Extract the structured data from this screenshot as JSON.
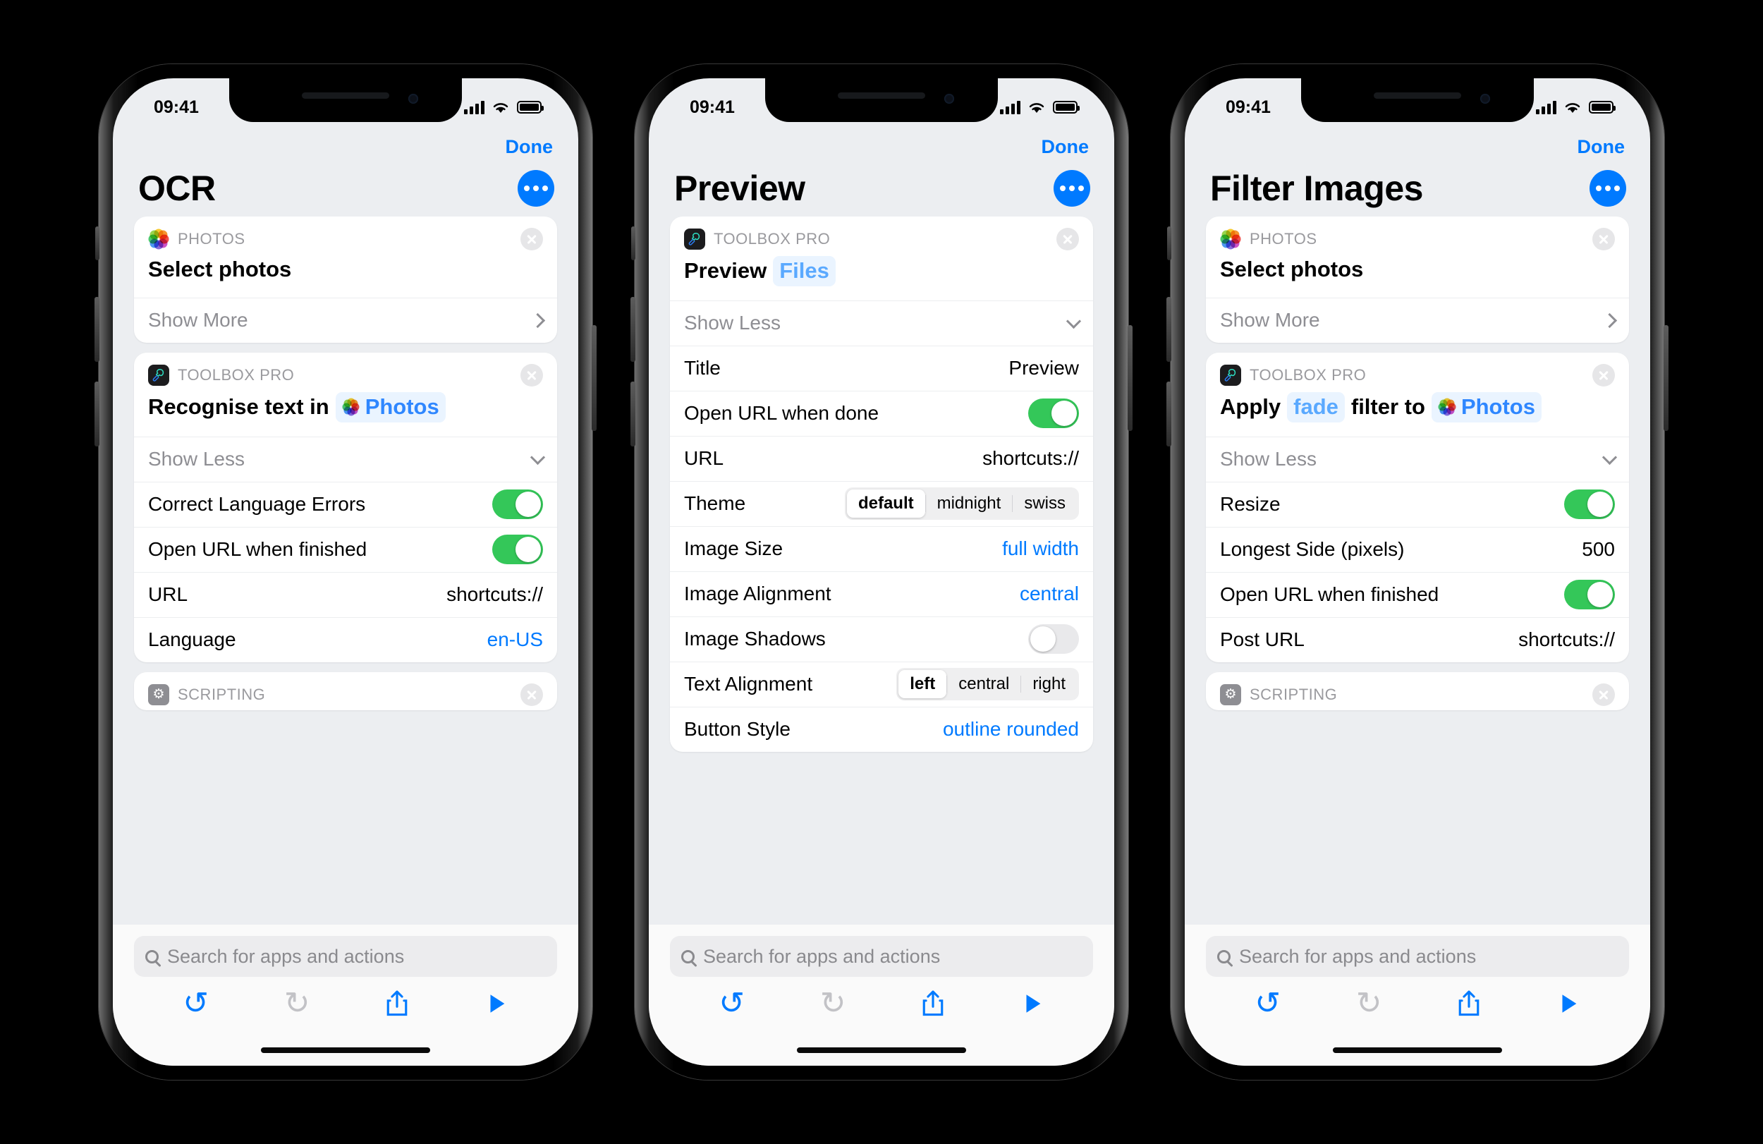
{
  "colors": {
    "accent": "#007aff",
    "toggle_on": "#34c759",
    "token_bg": "#eaf4ff",
    "token_text": "#2f87ff"
  },
  "status": {
    "time": "09:41",
    "signal_icon": "cellular-bars-icon",
    "wifi_icon": "wifi-icon",
    "battery_icon": "battery-full-icon"
  },
  "search": {
    "placeholder": "Search for apps and actions",
    "icon": "search-icon"
  },
  "toolbar": {
    "undo": "undo-icon",
    "redo": "redo-icon",
    "share": "share-icon",
    "run": "play-icon"
  },
  "phones": [
    {
      "nav": {
        "done": "Done",
        "title": "OCR",
        "more": "more-options-button"
      },
      "cards": [
        {
          "app": "PHOTOS",
          "app_icon": "photos-icon",
          "title_parts": [
            {
              "type": "text",
              "text": "Select photos"
            }
          ],
          "rows": [
            {
              "label": "Show More",
              "kind": "disclosure",
              "dim": true,
              "chevron": "chevron-right-icon"
            }
          ]
        },
        {
          "app": "TOOLBOX PRO",
          "app_icon": "toolbox-pro-icon",
          "title_parts": [
            {
              "type": "text",
              "text": "Recognise text in"
            },
            {
              "type": "token",
              "text": "Photos",
              "icon": "photos-icon"
            }
          ],
          "rows": [
            {
              "label": "Show Less",
              "kind": "disclosure",
              "dim": true,
              "chevron": "chevron-down-icon"
            },
            {
              "label": "Correct Language Errors",
              "kind": "toggle",
              "value": true
            },
            {
              "label": "Open URL when finished",
              "kind": "toggle",
              "value": true
            },
            {
              "label": "URL",
              "kind": "value",
              "value": "shortcuts://"
            },
            {
              "label": "Language",
              "kind": "value",
              "value": "en-US",
              "blue": true
            }
          ]
        },
        {
          "app": "SCRIPTING",
          "app_icon": "scripting-icon",
          "title_parts": [],
          "rows": []
        }
      ]
    },
    {
      "nav": {
        "done": "Done",
        "title": "Preview",
        "more": "more-options-button"
      },
      "cards": [
        {
          "app": "TOOLBOX PRO",
          "app_icon": "toolbox-pro-icon",
          "title_parts": [
            {
              "type": "text",
              "text": "Preview"
            },
            {
              "type": "token_plain",
              "text": "Files"
            }
          ],
          "rows": [
            {
              "label": "Show Less",
              "kind": "disclosure",
              "dim": true,
              "chevron": "chevron-down-icon"
            },
            {
              "label": "Title",
              "kind": "value",
              "value": "Preview"
            },
            {
              "label": "Open URL when done",
              "kind": "toggle",
              "value": true
            },
            {
              "label": "URL",
              "kind": "value",
              "value": "shortcuts://"
            },
            {
              "label": "Theme",
              "kind": "segmented",
              "options": [
                "default",
                "midnight",
                "swiss"
              ],
              "selected": "default"
            },
            {
              "label": "Image Size",
              "kind": "value",
              "value": "full width",
              "blue": true
            },
            {
              "label": "Image Alignment",
              "kind": "value",
              "value": "central",
              "blue": true
            },
            {
              "label": "Image Shadows",
              "kind": "toggle",
              "value": false
            },
            {
              "label": "Text Alignment",
              "kind": "segmented",
              "options": [
                "left",
                "central",
                "right"
              ],
              "selected": "left"
            },
            {
              "label": "Button Style",
              "kind": "value",
              "value": "outline rounded",
              "blue": true
            }
          ]
        }
      ]
    },
    {
      "nav": {
        "done": "Done",
        "title": "Filter Images",
        "more": "more-options-button"
      },
      "cards": [
        {
          "app": "PHOTOS",
          "app_icon": "photos-icon",
          "title_parts": [
            {
              "type": "text",
              "text": "Select photos"
            }
          ],
          "rows": [
            {
              "label": "Show More",
              "kind": "disclosure",
              "dim": true,
              "chevron": "chevron-right-icon"
            }
          ]
        },
        {
          "app": "TOOLBOX PRO",
          "app_icon": "toolbox-pro-icon",
          "title_parts": [
            {
              "type": "text",
              "text": "Apply"
            },
            {
              "type": "token_plain",
              "text": "fade"
            },
            {
              "type": "text",
              "text": "filter to"
            },
            {
              "type": "token",
              "text": "Photos",
              "icon": "photos-icon"
            }
          ],
          "rows": [
            {
              "label": "Show Less",
              "kind": "disclosure",
              "dim": true,
              "chevron": "chevron-down-icon"
            },
            {
              "label": "Resize",
              "kind": "toggle",
              "value": true
            },
            {
              "label": "Longest Side (pixels)",
              "kind": "value",
              "value": "500"
            },
            {
              "label": "Open URL when finished",
              "kind": "toggle",
              "value": true
            },
            {
              "label": "Post URL",
              "kind": "value",
              "value": "shortcuts://"
            }
          ]
        },
        {
          "app": "SCRIPTING",
          "app_icon": "scripting-icon",
          "title_parts": [],
          "rows": []
        }
      ]
    }
  ]
}
